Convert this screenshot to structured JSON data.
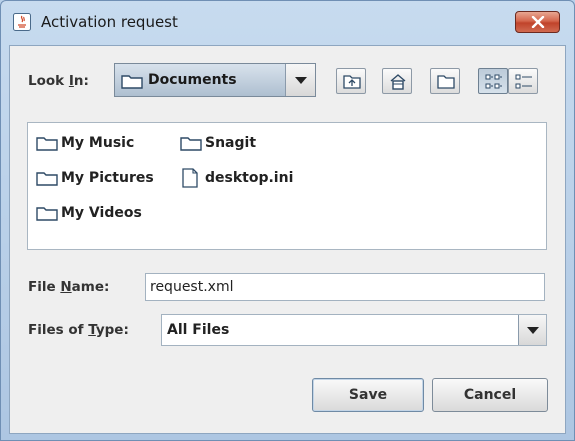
{
  "window": {
    "title": "Activation request"
  },
  "look_in": {
    "label_pre": "Look ",
    "label_mnemonic": "I",
    "label_post": "n:",
    "selected": "Documents"
  },
  "toolbar": {
    "icons": [
      "up-one-level-icon",
      "home-icon",
      "new-folder-icon",
      "list-view-icon",
      "details-view-icon"
    ]
  },
  "files": [
    {
      "name": "My Music",
      "type": "folder"
    },
    {
      "name": "My Pictures",
      "type": "folder"
    },
    {
      "name": "My Videos",
      "type": "folder"
    },
    {
      "name": "Snagit",
      "type": "folder"
    },
    {
      "name": "desktop.ini",
      "type": "file"
    }
  ],
  "file_name": {
    "label_pre": "File ",
    "label_mnemonic": "N",
    "label_post": "ame:",
    "value": "request.xml"
  },
  "file_type": {
    "label_pre": "Files of ",
    "label_mnemonic": "T",
    "label_post": "ype:",
    "selected": "All Files"
  },
  "buttons": {
    "save": "Save",
    "cancel": "Cancel"
  },
  "colors": {
    "accent": "#aebfd0",
    "close": "#c0432b"
  }
}
